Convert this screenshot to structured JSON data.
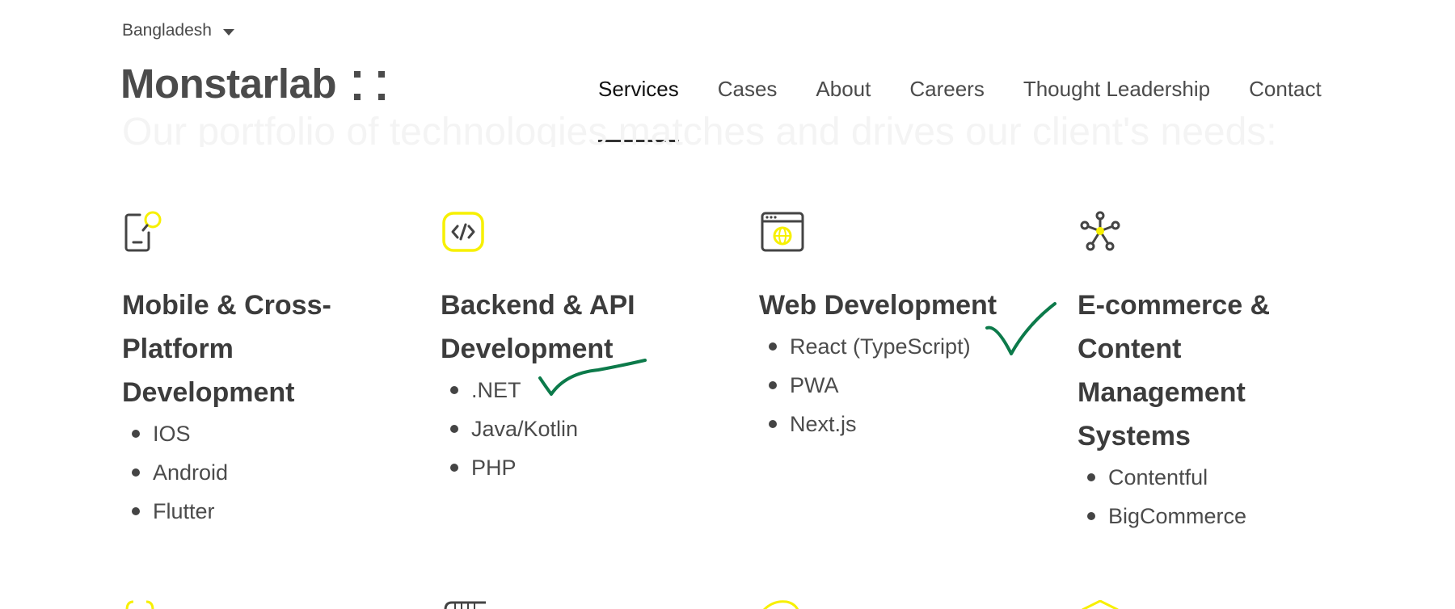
{
  "header": {
    "country": "Bangladesh",
    "logo_text": "Monstarlab",
    "nav": [
      "Services",
      "Cases",
      "About",
      "Careers",
      "Thought Leadership",
      "Contact"
    ]
  },
  "hero": {
    "ghost_heading": "Our portfolio of technologies matches and drives our client's needs:"
  },
  "services": [
    {
      "title": "Mobile & Cross-Platform Development",
      "icon": "mobile-search-icon",
      "items": [
        "IOS",
        "Android",
        "Flutter"
      ]
    },
    {
      "title": "Backend & API Development",
      "icon": "code-icon",
      "items": [
        ".NET",
        "Java/Kotlin",
        "PHP"
      ]
    },
    {
      "title": "Web Development",
      "icon": "browser-globe-icon",
      "items": [
        "React (TypeScript)",
        "PWA",
        "Next.js"
      ]
    },
    {
      "title": "E-commerce & Content Management Systems",
      "icon": "network-icon",
      "items": [
        "Contentful",
        "BigCommerce"
      ]
    }
  ],
  "colors": {
    "accent": "#f7f000",
    "text": "#444444",
    "annotation": "#0c7a4a"
  }
}
